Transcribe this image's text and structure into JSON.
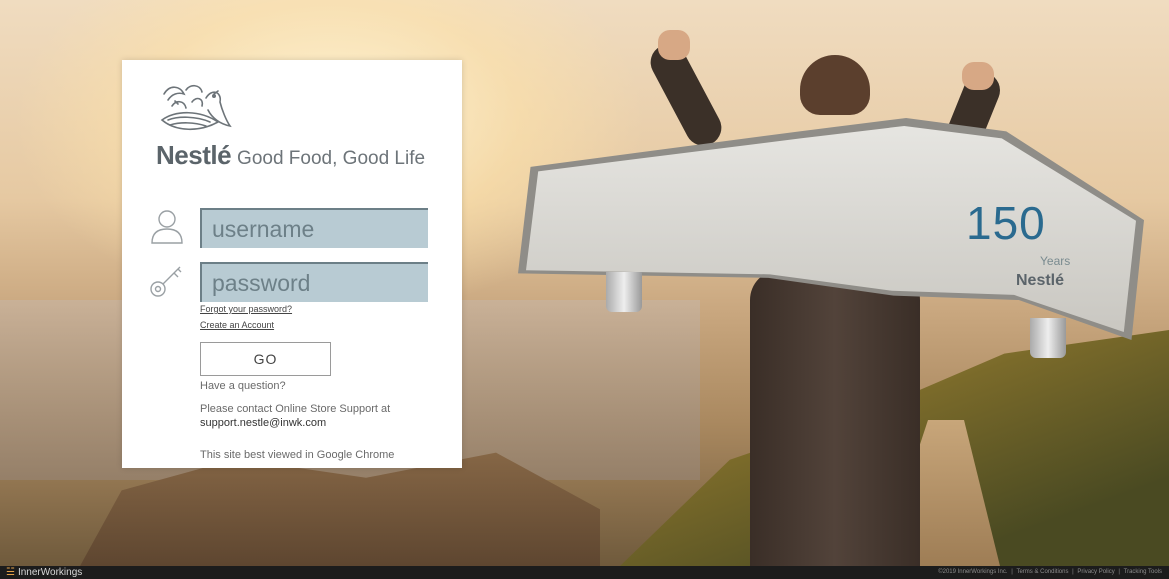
{
  "brand": {
    "name": "Nestlé",
    "tagline": "Good Food, Good Life"
  },
  "login": {
    "username_placeholder": "username",
    "password_placeholder": "password",
    "forgot_label": "Forgot your password?",
    "create_label": "Create an Account",
    "go_label": "GO"
  },
  "help": {
    "question": "Have a question?",
    "contact": "Please contact Online Store Support at",
    "email": "support.nestle@inwk.com",
    "browser_note": "This site best viewed in Google Chrome"
  },
  "anniversary": {
    "number": "150",
    "years": "Years",
    "brand": "Nestlé"
  },
  "footer": {
    "logo": "InnerWorkings",
    "copyright": "©2019 InnerWorkings Inc.",
    "terms": "Terms & Conditions",
    "privacy": "Privacy Policy",
    "tracking": "Tracking Tools",
    "separator": "|"
  },
  "colors": {
    "field_fill": "#b8cbd3",
    "card_bg": "#ffffff",
    "brand_gray": "#5b646a",
    "accent_orange": "#e4a24a"
  },
  "icons": {
    "user": "user-outline-icon",
    "key": "key-icon",
    "logo": "nest-bird-logo-icon",
    "footer": "innerworkings-logo-icon"
  }
}
